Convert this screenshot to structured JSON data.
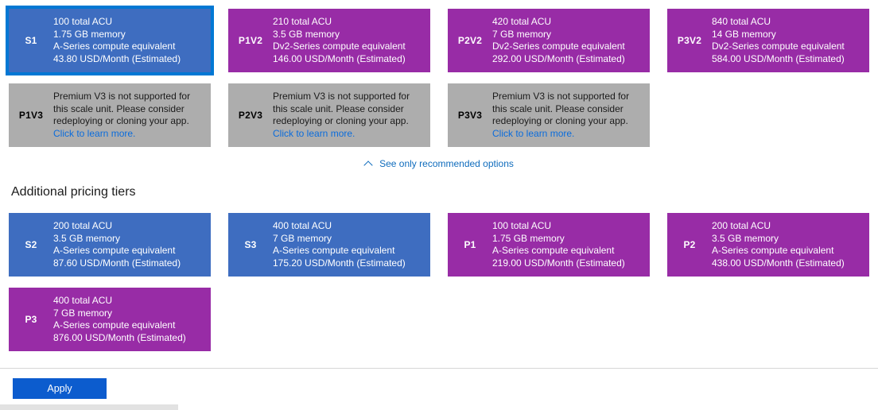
{
  "recommended_tiers": [
    {
      "code": "S1",
      "selected": true,
      "style": "blue",
      "acu": "100 total ACU",
      "memory": "1.75 GB memory",
      "compute": "A-Series compute equivalent",
      "price": "43.80 USD/Month (Estimated)"
    },
    {
      "code": "P1V2",
      "selected": false,
      "style": "purple",
      "acu": "210 total ACU",
      "memory": "3.5 GB memory",
      "compute": "Dv2-Series compute equivalent",
      "price": "146.00 USD/Month (Estimated)"
    },
    {
      "code": "P2V2",
      "selected": false,
      "style": "purple",
      "acu": "420 total ACU",
      "memory": "7 GB memory",
      "compute": "Dv2-Series compute equivalent",
      "price": "292.00 USD/Month (Estimated)"
    },
    {
      "code": "P3V2",
      "selected": false,
      "style": "purple",
      "acu": "840 total ACU",
      "memory": "14 GB memory",
      "compute": "Dv2-Series compute equivalent",
      "price": "584.00 USD/Month (Estimated)"
    }
  ],
  "unsupported_tiers": [
    {
      "code": "P1V3",
      "message": "Premium V3 is not supported for this scale unit. Please consider redeploying or cloning your app.",
      "link": "Click to learn more."
    },
    {
      "code": "P2V3",
      "message": "Premium V3 is not supported for this scale unit. Please consider redeploying or cloning your app.",
      "link": "Click to learn more."
    },
    {
      "code": "P3V3",
      "message": "Premium V3 is not supported for this scale unit. Please consider redeploying or cloning your app.",
      "link": "Click to learn more."
    }
  ],
  "toggle": {
    "label": "See only recommended options",
    "icon": "chevron-up-icon"
  },
  "additional_section": {
    "heading": "Additional pricing tiers",
    "tiers": [
      {
        "code": "S2",
        "style": "blue",
        "acu": "200 total ACU",
        "memory": "3.5 GB memory",
        "compute": "A-Series compute equivalent",
        "price": "87.60 USD/Month (Estimated)"
      },
      {
        "code": "S3",
        "style": "blue",
        "acu": "400 total ACU",
        "memory": "7 GB memory",
        "compute": "A-Series compute equivalent",
        "price": "175.20 USD/Month (Estimated)"
      },
      {
        "code": "P1",
        "style": "purple",
        "acu": "100 total ACU",
        "memory": "1.75 GB memory",
        "compute": "A-Series compute equivalent",
        "price": "219.00 USD/Month (Estimated)"
      },
      {
        "code": "P2",
        "style": "purple",
        "acu": "200 total ACU",
        "memory": "3.5 GB memory",
        "compute": "A-Series compute equivalent",
        "price": "438.00 USD/Month (Estimated)"
      },
      {
        "code": "P3",
        "style": "purple",
        "acu": "400 total ACU",
        "memory": "7 GB memory",
        "compute": "A-Series compute equivalent",
        "price": "876.00 USD/Month (Estimated)"
      }
    ]
  },
  "footer": {
    "apply_label": "Apply"
  },
  "colors": {
    "blue_card": "#3e6dc0",
    "purple_card": "#982ca6",
    "disabled_card": "#adadad",
    "selection_border": "#0078d4",
    "link": "#0f6cbd",
    "apply_button": "#0c5cce"
  }
}
